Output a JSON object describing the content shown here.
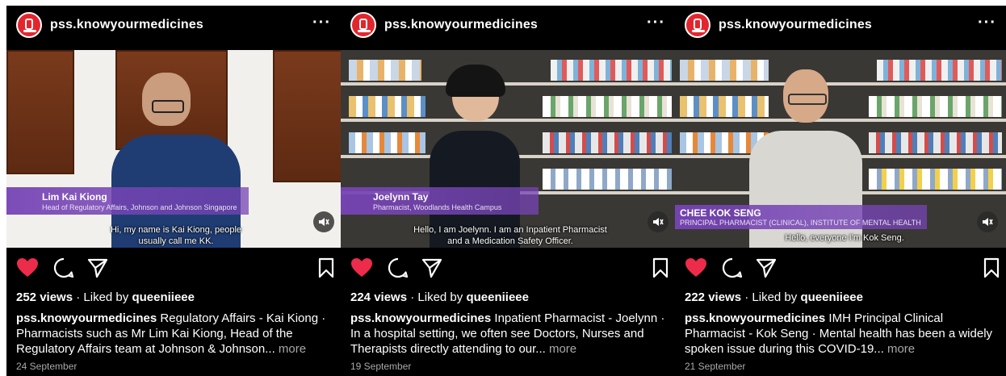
{
  "posts": [
    {
      "username": "pss.knowyourmedicines",
      "lower_third": {
        "name": "Lim Kai Kiong",
        "title": "Head of Regulatory Affairs, Johnson and Johnson Singapore"
      },
      "subtitle": "Hi, my name is Kai Kiong, people\nusually call me KK.",
      "views": "252 views",
      "liked_prefix": "Liked by",
      "liked_user": "queeniieee",
      "caption_user": "pss.knowyourmedicines",
      "caption_text": "Regulatory Affairs - Kai Kiong · Pharmacists such as Mr Lim Kai Kiong, Head of the Regulatory Affairs team at Johnson & Johnson...",
      "more": "more",
      "date": "24 September"
    },
    {
      "username": "pss.knowyourmedicines",
      "lower_third": {
        "name": "Joelynn Tay",
        "title": "Pharmacist, Woodlands Health Campus"
      },
      "subtitle": "Hello, I am Joelynn. I am an Inpatient Pharmacist\nand a Medication Safety Officer.",
      "views": "224 views",
      "liked_prefix": "Liked by",
      "liked_user": "queeniieee",
      "caption_user": "pss.knowyourmedicines",
      "caption_text": "Inpatient Pharmacist - Joelynn · In a hospital setting, we often see Doctors, Nurses and Therapists directly attending to our...",
      "more": "more",
      "date": "19 September"
    },
    {
      "username": "pss.knowyourmedicines",
      "lower_third": {
        "name": "CHEE KOK SENG",
        "title": "PRINCIPAL PHARMACIST (CLINICAL), INSTITUTE OF MENTAL HEALTH"
      },
      "subtitle": "Hello, everyone I'm Kok Seng.",
      "views": "222 views",
      "liked_prefix": "Liked by",
      "liked_user": "queeniieee",
      "caption_user": "pss.knowyourmedicines",
      "caption_text": "IMH Principal Clinical Pharmacist - Kok Seng · Mental health has been a widely spoken issue during this COVID-19...",
      "more": "more",
      "date": "21 September"
    }
  ],
  "colors": {
    "like": "#ed2b4b",
    "lower_third": "#7644b5",
    "brand": "#e3262d"
  },
  "icons": [
    "heart-icon",
    "comment-icon",
    "share-icon",
    "bookmark-icon",
    "mute-icon",
    "more-icon"
  ]
}
